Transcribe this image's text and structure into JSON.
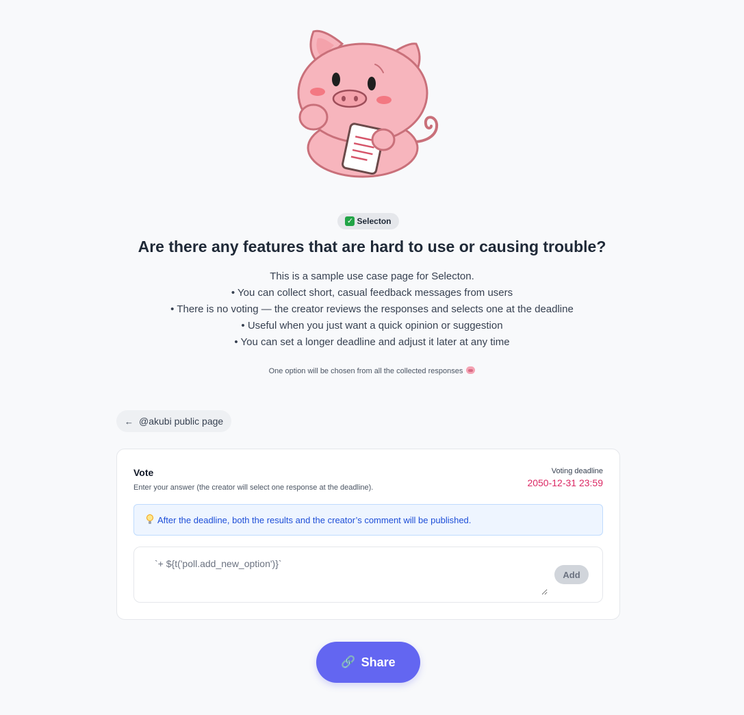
{
  "mascot": {
    "icon": "pig-mascot-holding-note"
  },
  "badge": {
    "icon": "check-icon",
    "label": "Selecton"
  },
  "title": "Are there any features that are hard to use or causing trouble?",
  "description": [
    "This is a sample use case page for Selecton.",
    "• You can collect short, casual feedback messages from users",
    "• There is no voting — the creator reviews the responses and selects one at the deadline",
    "• Useful when you just want a quick opinion or suggestion",
    "• You can set a longer deadline and adjust it later at any time"
  ],
  "note": {
    "text": "One option will be chosen from all the collected responses",
    "icon": "pig-face-icon"
  },
  "back_link": {
    "icon": "arrow-left-icon",
    "label": "@akubi public page"
  },
  "vote": {
    "title": "Vote",
    "subtitle": "Enter your answer (the creator will select one response at the deadline).",
    "deadline_label": "Voting deadline",
    "deadline_value": "2050-12-31 23:59",
    "info": {
      "icon": "lightbulb-icon",
      "text": "After the deadline, both the results and the creator’s comment will be published."
    },
    "input_placeholder": "`+ ${t('poll.add_new_option')}`",
    "add_label": "Add"
  },
  "share": {
    "icon": "link-icon",
    "label": "Share"
  },
  "colors": {
    "accent": "#6366f1",
    "deadline": "#db2763",
    "info_text": "#1d4ed8",
    "info_bg": "#eef5ff"
  }
}
